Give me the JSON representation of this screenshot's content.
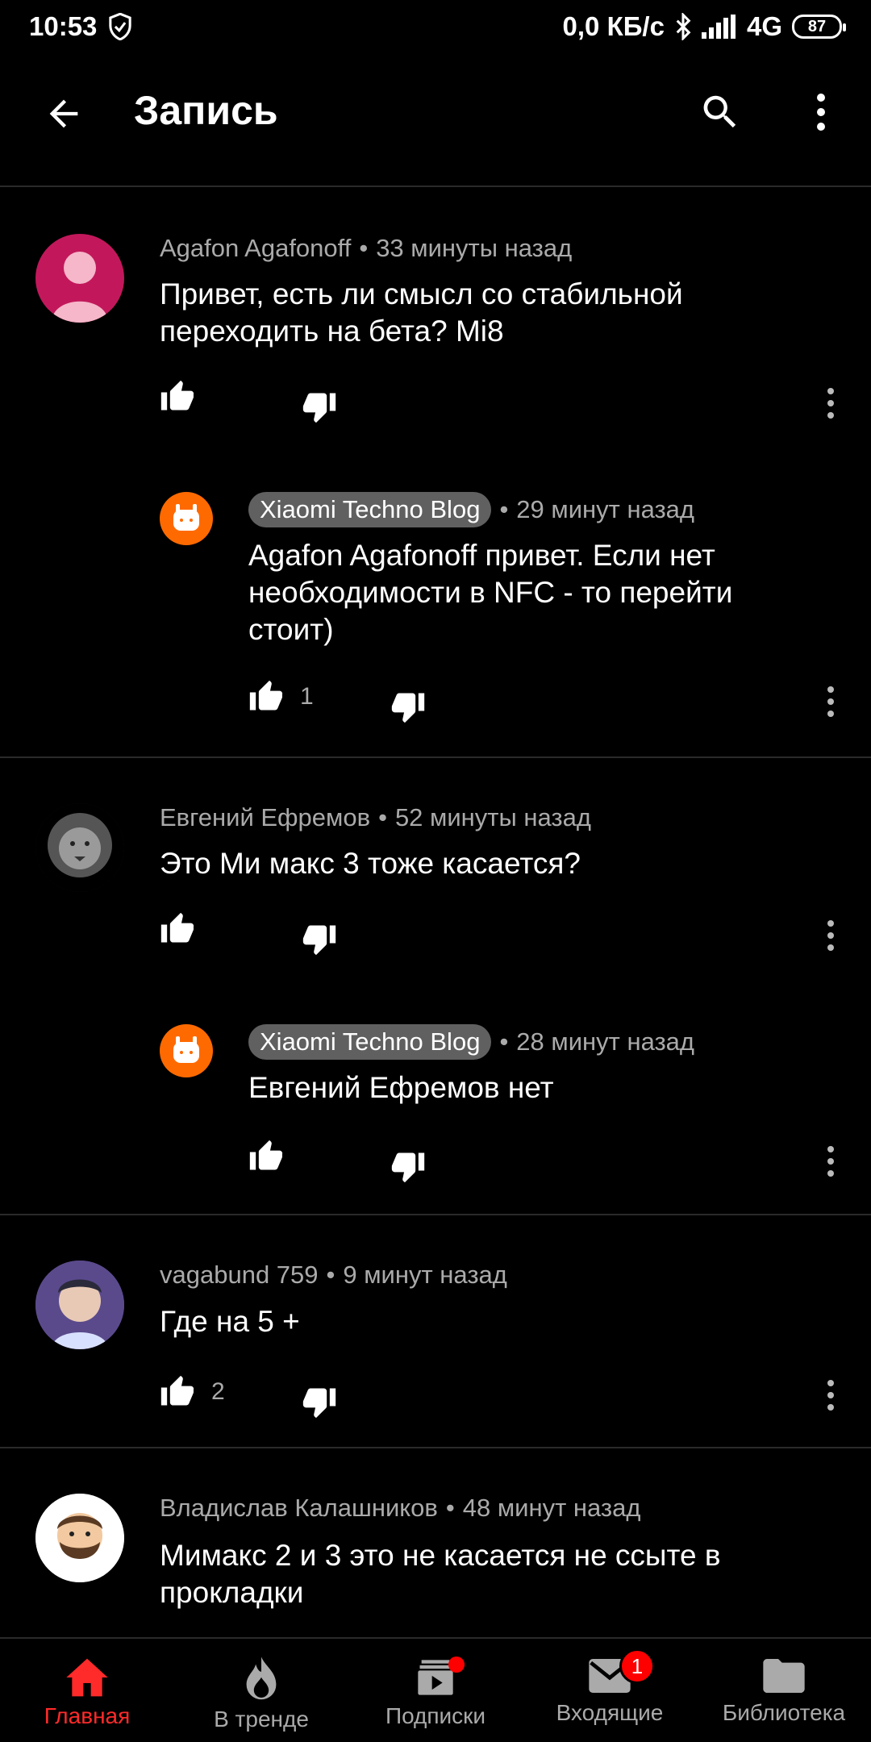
{
  "status": {
    "time": "10:53",
    "net": "0,0 КБ/с",
    "signal": "4G",
    "battery": "87"
  },
  "appbar": {
    "title": "Запись"
  },
  "comments": [
    {
      "author": "Agafon Agafonoff",
      "time": "33 минуты назад",
      "text": "Привет, есть ли смысл со стабильной переходить на бета? Mi8",
      "likes": ""
    },
    {
      "author": "Xiaomi Techno Blog",
      "time": "29 минут назад",
      "text": "Agafon Agafonoff привет. Если нет необходимости в NFC - то перейти стоит)",
      "likes": "1"
    },
    {
      "author": "Евгений Ефремов",
      "time": "52 минуты назад",
      "text": "Это Ми макс 3 тоже касается?",
      "likes": ""
    },
    {
      "author": "Xiaomi Techno Blog",
      "time": "28 минут назад",
      "text": "Евгений Ефремов нет",
      "likes": ""
    },
    {
      "author": "vagabund 759",
      "time": "9 минут назад",
      "text": "Где на 5 +",
      "likes": "2"
    },
    {
      "author": "Владислав Калашников",
      "time": "48 минут назад",
      "text": "Мимакс 2 и 3 это не касается не ссыте в прокладки",
      "likes": ""
    }
  ],
  "nav": [
    {
      "label": "Главная"
    },
    {
      "label": "В тренде"
    },
    {
      "label": "Подписки"
    },
    {
      "label": "Входящие",
      "badge": "1"
    },
    {
      "label": "Библиотека"
    }
  ],
  "colors": {
    "accent": "#ff0000",
    "background": "#000000",
    "meta": "#aaaaaa",
    "chip": "#606060"
  }
}
